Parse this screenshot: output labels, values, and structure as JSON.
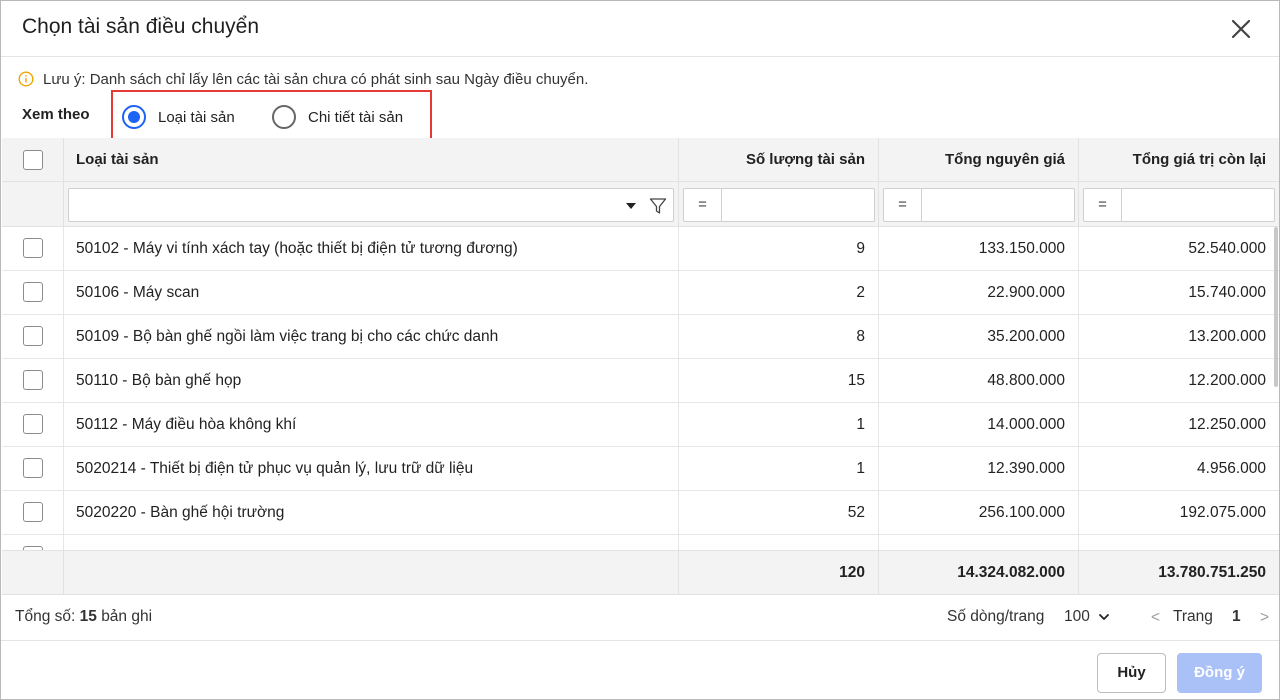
{
  "dialog": {
    "title": "Chọn tài sản điều chuyển",
    "note": "Lưu ý: Danh sách chỉ lấy lên các tài sản chưa có phát sinh sau Ngày điều chuyển.",
    "view_by_label": "Xem theo",
    "view_options": [
      {
        "label": "Loại tài sản",
        "selected": true
      },
      {
        "label": "Chi tiết tài sản",
        "selected": false
      }
    ]
  },
  "table": {
    "columns": {
      "type": "Loại tài sản",
      "quantity": "Số lượng tài sản",
      "original_cost": "Tổng nguyên giá",
      "remaining_value": "Tổng giá trị còn lại"
    },
    "filter_operator": "=",
    "rows": [
      {
        "type": "50102 - Máy vi tính xách tay (hoặc thiết bị điện tử tương đương)",
        "quantity": "9",
        "original_cost": "133.150.000",
        "remaining_value": "52.540.000"
      },
      {
        "type": "50106 - Máy scan",
        "quantity": "2",
        "original_cost": "22.900.000",
        "remaining_value": "15.740.000"
      },
      {
        "type": "50109 - Bộ bàn ghế ngồi làm việc trang bị cho các chức danh",
        "quantity": "8",
        "original_cost": "35.200.000",
        "remaining_value": "13.200.000"
      },
      {
        "type": "50110 - Bộ bàn ghế họp",
        "quantity": "15",
        "original_cost": "48.800.000",
        "remaining_value": "12.200.000"
      },
      {
        "type": "50112 - Máy điều hòa không khí",
        "quantity": "1",
        "original_cost": "14.000.000",
        "remaining_value": "12.250.000"
      },
      {
        "type": "5020214 - Thiết bị điện tử phục vụ quản lý, lưu trữ dữ liệu",
        "quantity": "1",
        "original_cost": "12.390.000",
        "remaining_value": "4.956.000"
      },
      {
        "type": "5020220 - Bàn ghế hội trường",
        "quantity": "52",
        "original_cost": "256.100.000",
        "remaining_value": "192.075.000"
      }
    ],
    "totals": {
      "quantity": "120",
      "original_cost": "14.324.082.000",
      "remaining_value": "13.780.751.250"
    }
  },
  "pager": {
    "total_label": "Tổng số:",
    "total_count": "15",
    "total_suffix": "bản ghi",
    "page_size_label": "Số dòng/trang",
    "page_size": "100",
    "prev": "<",
    "page_label": "Trang",
    "page_number": "1",
    "next": ">"
  },
  "buttons": {
    "cancel": "Hủy",
    "confirm": "Đồng ý"
  },
  "colors": {
    "accent": "#1e63f3",
    "highlight_border": "#e53935",
    "disabled_button": "#a9c1f7",
    "info_icon": "#f0a500"
  }
}
